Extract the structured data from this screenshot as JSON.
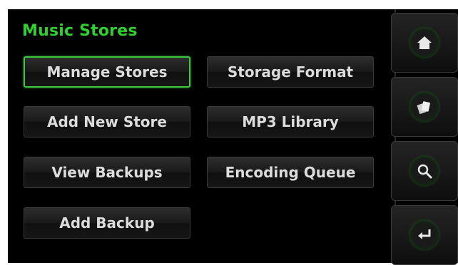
{
  "screen": {
    "title": "Music Stores"
  },
  "buttons": {
    "manage_stores": "Manage Stores",
    "add_new_store": "Add New Store",
    "view_backups": "View Backups",
    "add_backup": "Add Backup",
    "storage_format": "Storage Format",
    "mp3_library": "MP3 Library",
    "encoding_queue": "Encoding Queue"
  },
  "selected_button": "Manage Stores",
  "sidebar": {
    "icons": [
      "home-icon",
      "cards-icon",
      "search-icon",
      "return-icon"
    ]
  },
  "colors": {
    "accent": "#2fd12f",
    "selected_border": "#3fc83f",
    "background": "#000000"
  }
}
